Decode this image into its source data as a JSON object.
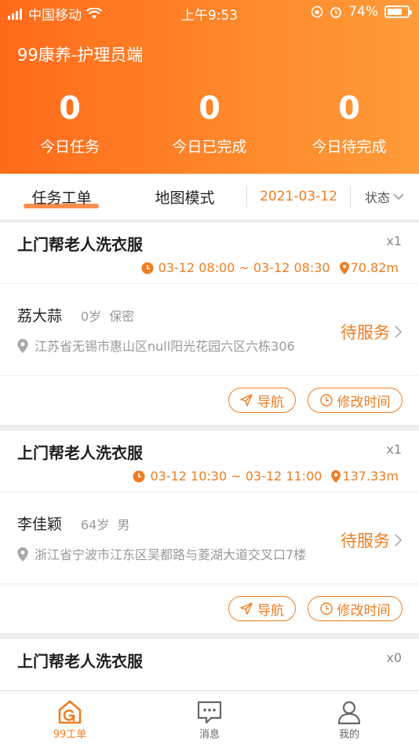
{
  "status_bar": {
    "carrier": "中国移动",
    "time": "上午9:53",
    "battery": "74%",
    "battery_level": 0.74
  },
  "header": {
    "title": "99康养-护理员端",
    "stats": [
      {
        "value": "0",
        "label": "今日任务"
      },
      {
        "value": "0",
        "label": "今日已完成"
      },
      {
        "value": "0",
        "label": "今日待完成"
      }
    ]
  },
  "tabs": {
    "task": "任务工单",
    "map": "地图模式",
    "date": "2021-03-12",
    "status": "状态"
  },
  "orders": [
    {
      "title": "上门帮老人洗衣服",
      "qty": "x1",
      "time": "03-12 08:00 ~ 03-12 08:30",
      "distance": "70.82m",
      "name": "荔大蒜",
      "age": "0岁",
      "gender": "保密",
      "address": "江苏省无锡市惠山区null阳光花园六区六栋306",
      "state": "待服务",
      "nav_label": "导航",
      "edit_label": "修改时间"
    },
    {
      "title": "上门帮老人洗衣服",
      "qty": "x1",
      "time": "03-12 10:30 ~ 03-12 11:00",
      "distance": "137.33m",
      "name": "李佳颖",
      "age": "64岁",
      "gender": "男",
      "address": "浙江省宁波市江东区吴都路与菱湖大道交叉口7楼",
      "state": "待服务",
      "nav_label": "导航",
      "edit_label": "修改时间"
    },
    {
      "title": "上门帮老人洗衣服",
      "qty": "x0"
    }
  ],
  "bottom_nav": [
    {
      "label": "99工单",
      "icon": "home-g-icon",
      "active": true
    },
    {
      "label": "消息",
      "icon": "message-icon",
      "active": false
    },
    {
      "label": "我的",
      "icon": "user-icon",
      "active": false
    }
  ],
  "colors": {
    "accent": "#f07d21",
    "header_start": "#ff6a1a",
    "header_end": "#ff9b3a"
  }
}
